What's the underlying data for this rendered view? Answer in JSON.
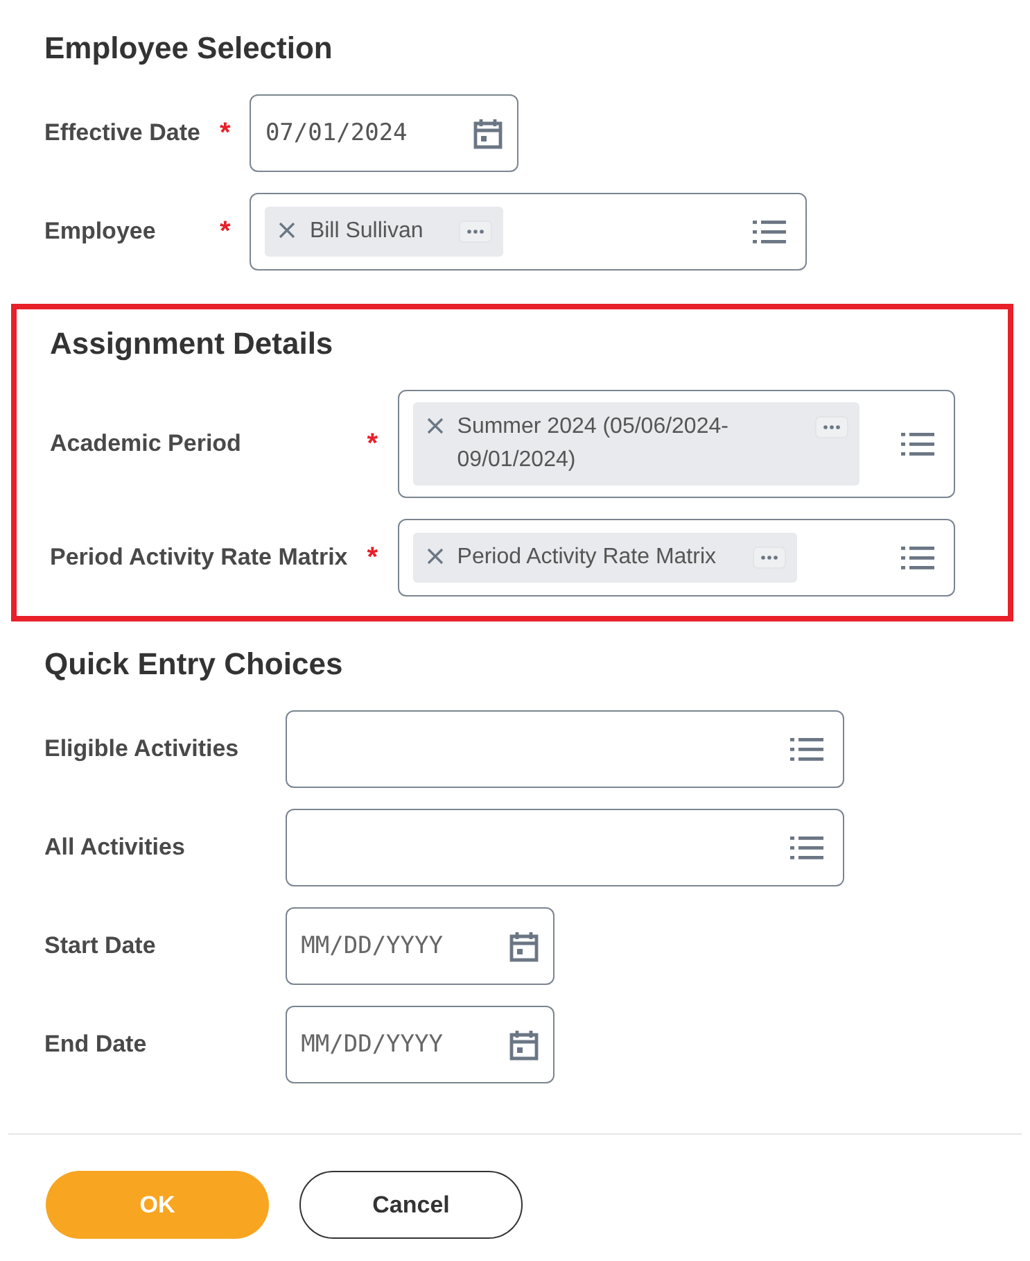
{
  "sections": [
    {
      "title": "Employee Selection",
      "highlighted": false,
      "fields": [
        {
          "label": "Effective Date",
          "required_mark": "*",
          "kind": "date",
          "value": "07/01/2024"
        },
        {
          "label": "Employee",
          "required_mark": "*",
          "kind": "prompt",
          "chips": [
            "Bill Sullivan"
          ]
        }
      ]
    },
    {
      "title": "Assignment Details",
      "highlighted": true,
      "fields": [
        {
          "label": "Academic Period",
          "required_mark": "*",
          "kind": "prompt",
          "chips": [
            "Summer 2024 (05/06/2024-09/01/2024)"
          ]
        },
        {
          "label": "Period Activity Rate Matrix",
          "required_mark": "*",
          "kind": "prompt",
          "chips": [
            "Period Activity Rate Matrix"
          ]
        }
      ]
    },
    {
      "title": "Quick Entry Choices",
      "highlighted": false,
      "fields": [
        {
          "label": "Eligible Activities",
          "kind": "prompt"
        },
        {
          "label": "All Activities",
          "kind": "prompt"
        },
        {
          "label": "Start Date",
          "kind": "date",
          "placeholder": "MM/DD/YYYY"
        },
        {
          "label": "End Date",
          "kind": "date",
          "placeholder": "MM/DD/YYYY"
        }
      ]
    }
  ],
  "buttons": [
    {
      "label": "OK",
      "kind": "primary"
    },
    {
      "label": "Cancel",
      "kind": "secondary"
    }
  ]
}
